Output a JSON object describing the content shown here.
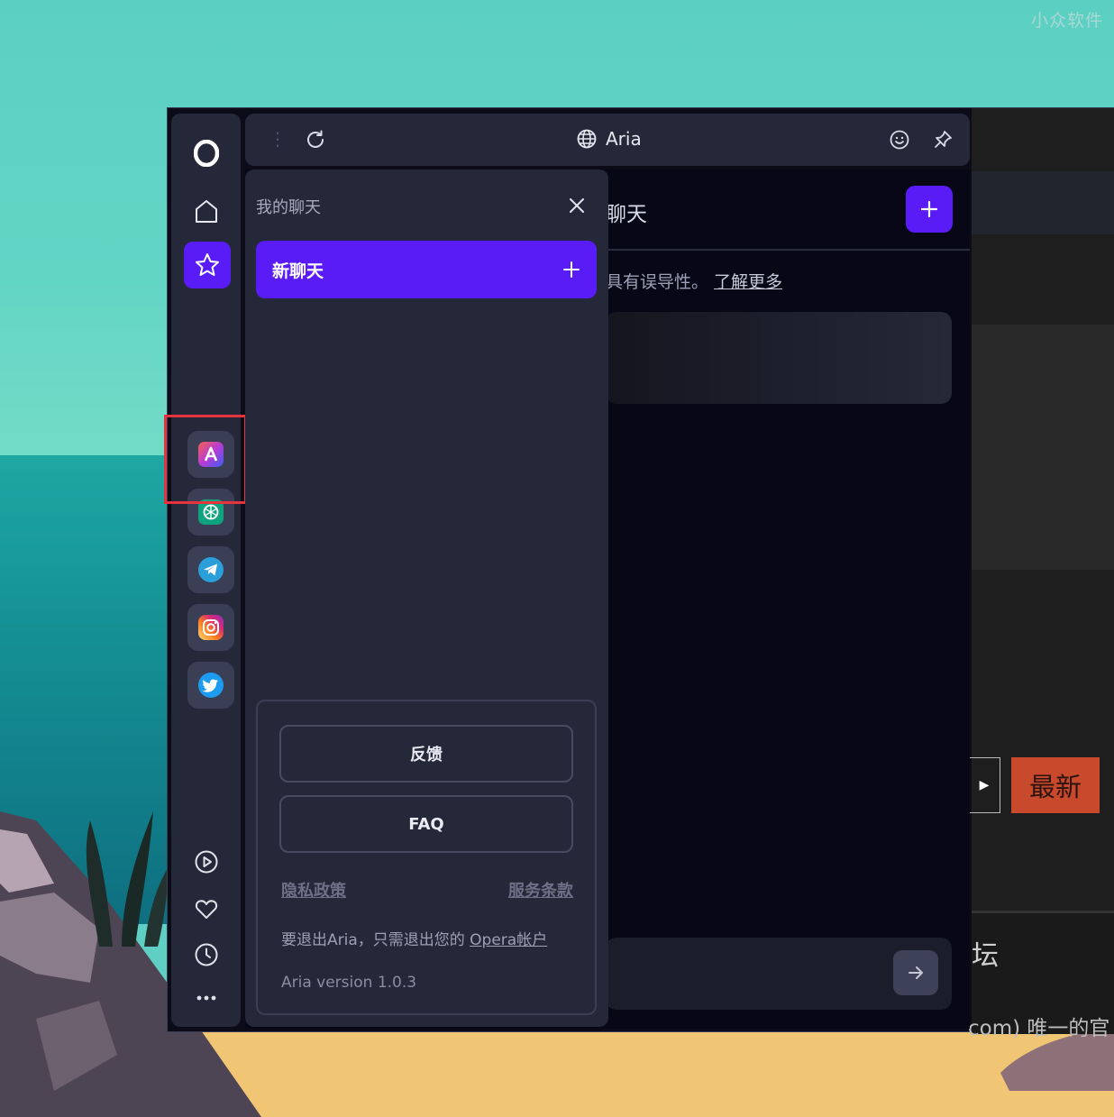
{
  "watermark": "小众软件",
  "panel": {
    "title": "Aria"
  },
  "rail": {
    "apps": [
      "aria",
      "chatgpt",
      "telegram",
      "instagram",
      "twitter"
    ]
  },
  "aria_background": {
    "header_text": "聊天",
    "warning_text": "具有误导性。",
    "learn_more": "了解更多"
  },
  "drawer": {
    "title": "我的聊天",
    "new_chat": "新聊天",
    "feedback": "反馈",
    "faq": "FAQ",
    "privacy": "隐私政策",
    "terms": "服务条款",
    "logout_prefix": "要退出Aria，只需退出您的 ",
    "logout_link": "Opera帐户",
    "version": "Aria version 1.0.3"
  },
  "site_preview": {
    "new_button": "最新",
    "forum": "坛",
    "domain": "com) 唯一的官"
  },
  "colors": {
    "accent": "#5a1cf6",
    "highlight": "#e5343f"
  }
}
